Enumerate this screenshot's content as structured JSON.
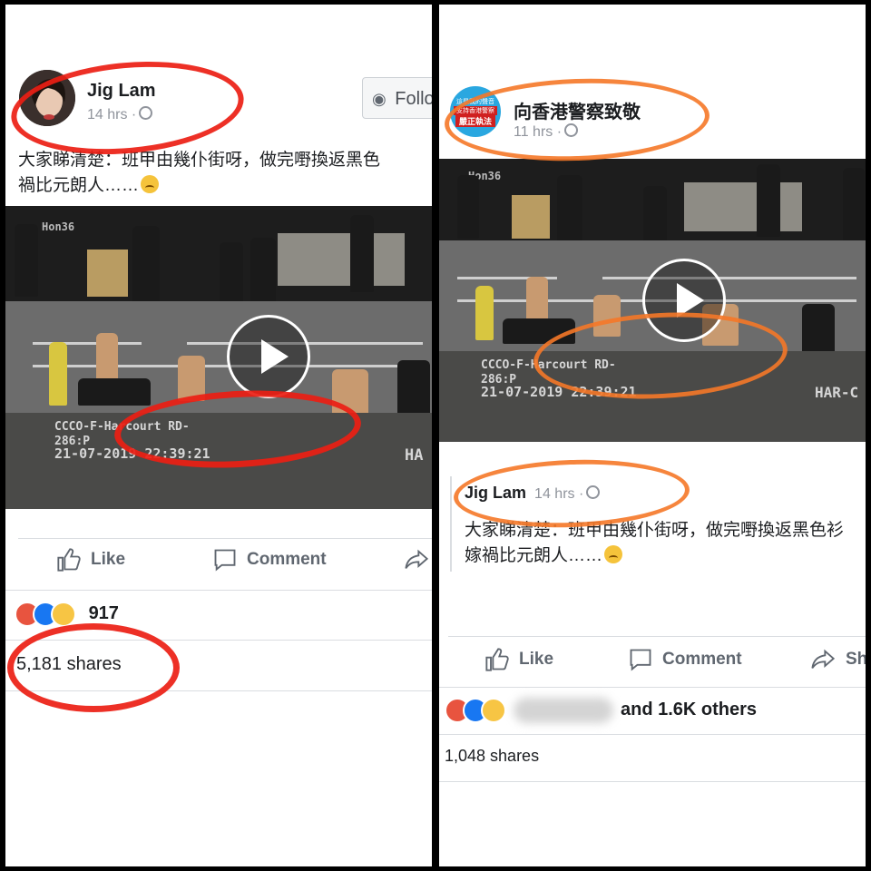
{
  "left_post": {
    "author": "Jig Lam",
    "time": "14 hrs ·",
    "follow_label": "Follo",
    "text_line1": "大家睇清楚：班甲由幾仆街呀，做完嘢換返黑色",
    "text_line2": "禍比元朗人……",
    "cctv_label": "CCCO-F-Harcourt RD-",
    "cctv_code": "286:P",
    "cctv_time": "21-07-2019 22:39:21",
    "cctv_corner": "Hon36",
    "cctv_side": "HA",
    "actions": {
      "like": "Like",
      "comment": "Comment"
    },
    "reaction_count": "917",
    "shares": "5,181 shares"
  },
  "right_post": {
    "author": "向香港警察致敬",
    "time": "11 hrs ·",
    "avatar_text": [
      "這是我的聲音",
      "支持香港警察",
      "嚴正執法"
    ],
    "cctv_label": "CCCO-F-Harcourt RD-",
    "cctv_code": "286:P",
    "cctv_time": "21-07-2019 22:39:21",
    "cctv_corner": "Hon36",
    "cctv_side": "HAR-C",
    "shared_author": "Jig Lam",
    "shared_time": "14 hrs ·",
    "shared_text_line1": "大家睇清楚：班甲由幾仆街呀，做完嘢換返黑色衫",
    "shared_text_line2": "嫁禍比元朗人……",
    "actions": {
      "like": "Like",
      "comment": "Comment",
      "share": "Sha"
    },
    "reaction_text": "and 1.6K others",
    "shares": "1,048 shares"
  },
  "colors": {
    "red_marker": "#eb1e14",
    "orange_marker": "#f57828",
    "facebook_blue": "#1877f2"
  },
  "icons": [
    "globe-icon",
    "play-icon",
    "like-icon",
    "comment-icon",
    "share-icon",
    "rss-icon",
    "angry-reaction-icon",
    "like-reaction-icon",
    "wow-reaction-icon"
  ]
}
